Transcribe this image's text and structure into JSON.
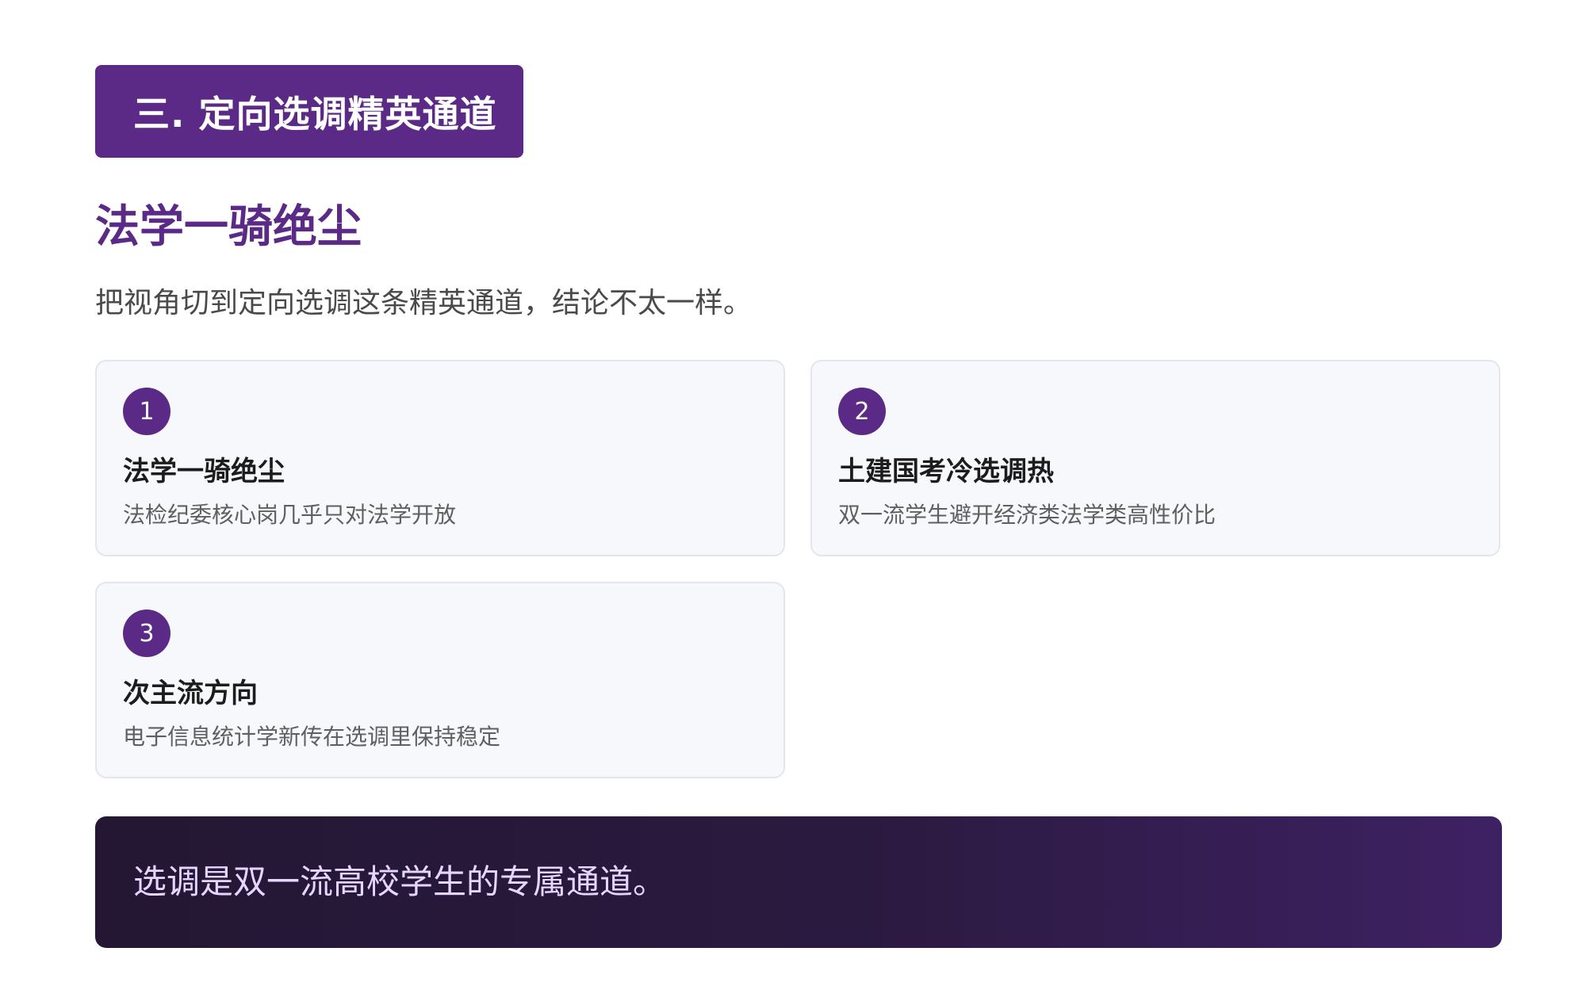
{
  "section_tag": "三. 定向选调精英通道",
  "heading": "法学一骑绝尘",
  "subtitle": "把视角切到定向选调这条精英通道，结论不太一样。",
  "cards": [
    {
      "number": "1",
      "title": "法学一骑绝尘",
      "description": "法检纪委核心岗几乎只对法学开放"
    },
    {
      "number": "2",
      "title": "土建国考冷选调热",
      "description": "双一流学生避开经济类法学类高性价比"
    },
    {
      "number": "3",
      "title": "次主流方向",
      "description": "电子信息统计学新传在选调里保持稳定"
    }
  ],
  "banner": "选调是双一流高校学生的专属通道。",
  "colors": {
    "accent": "#5b2a86",
    "card_background": "#f7f8fb",
    "banner_start": "#231733",
    "banner_end": "#3e2163",
    "banner_text": "#e7d5ff"
  }
}
